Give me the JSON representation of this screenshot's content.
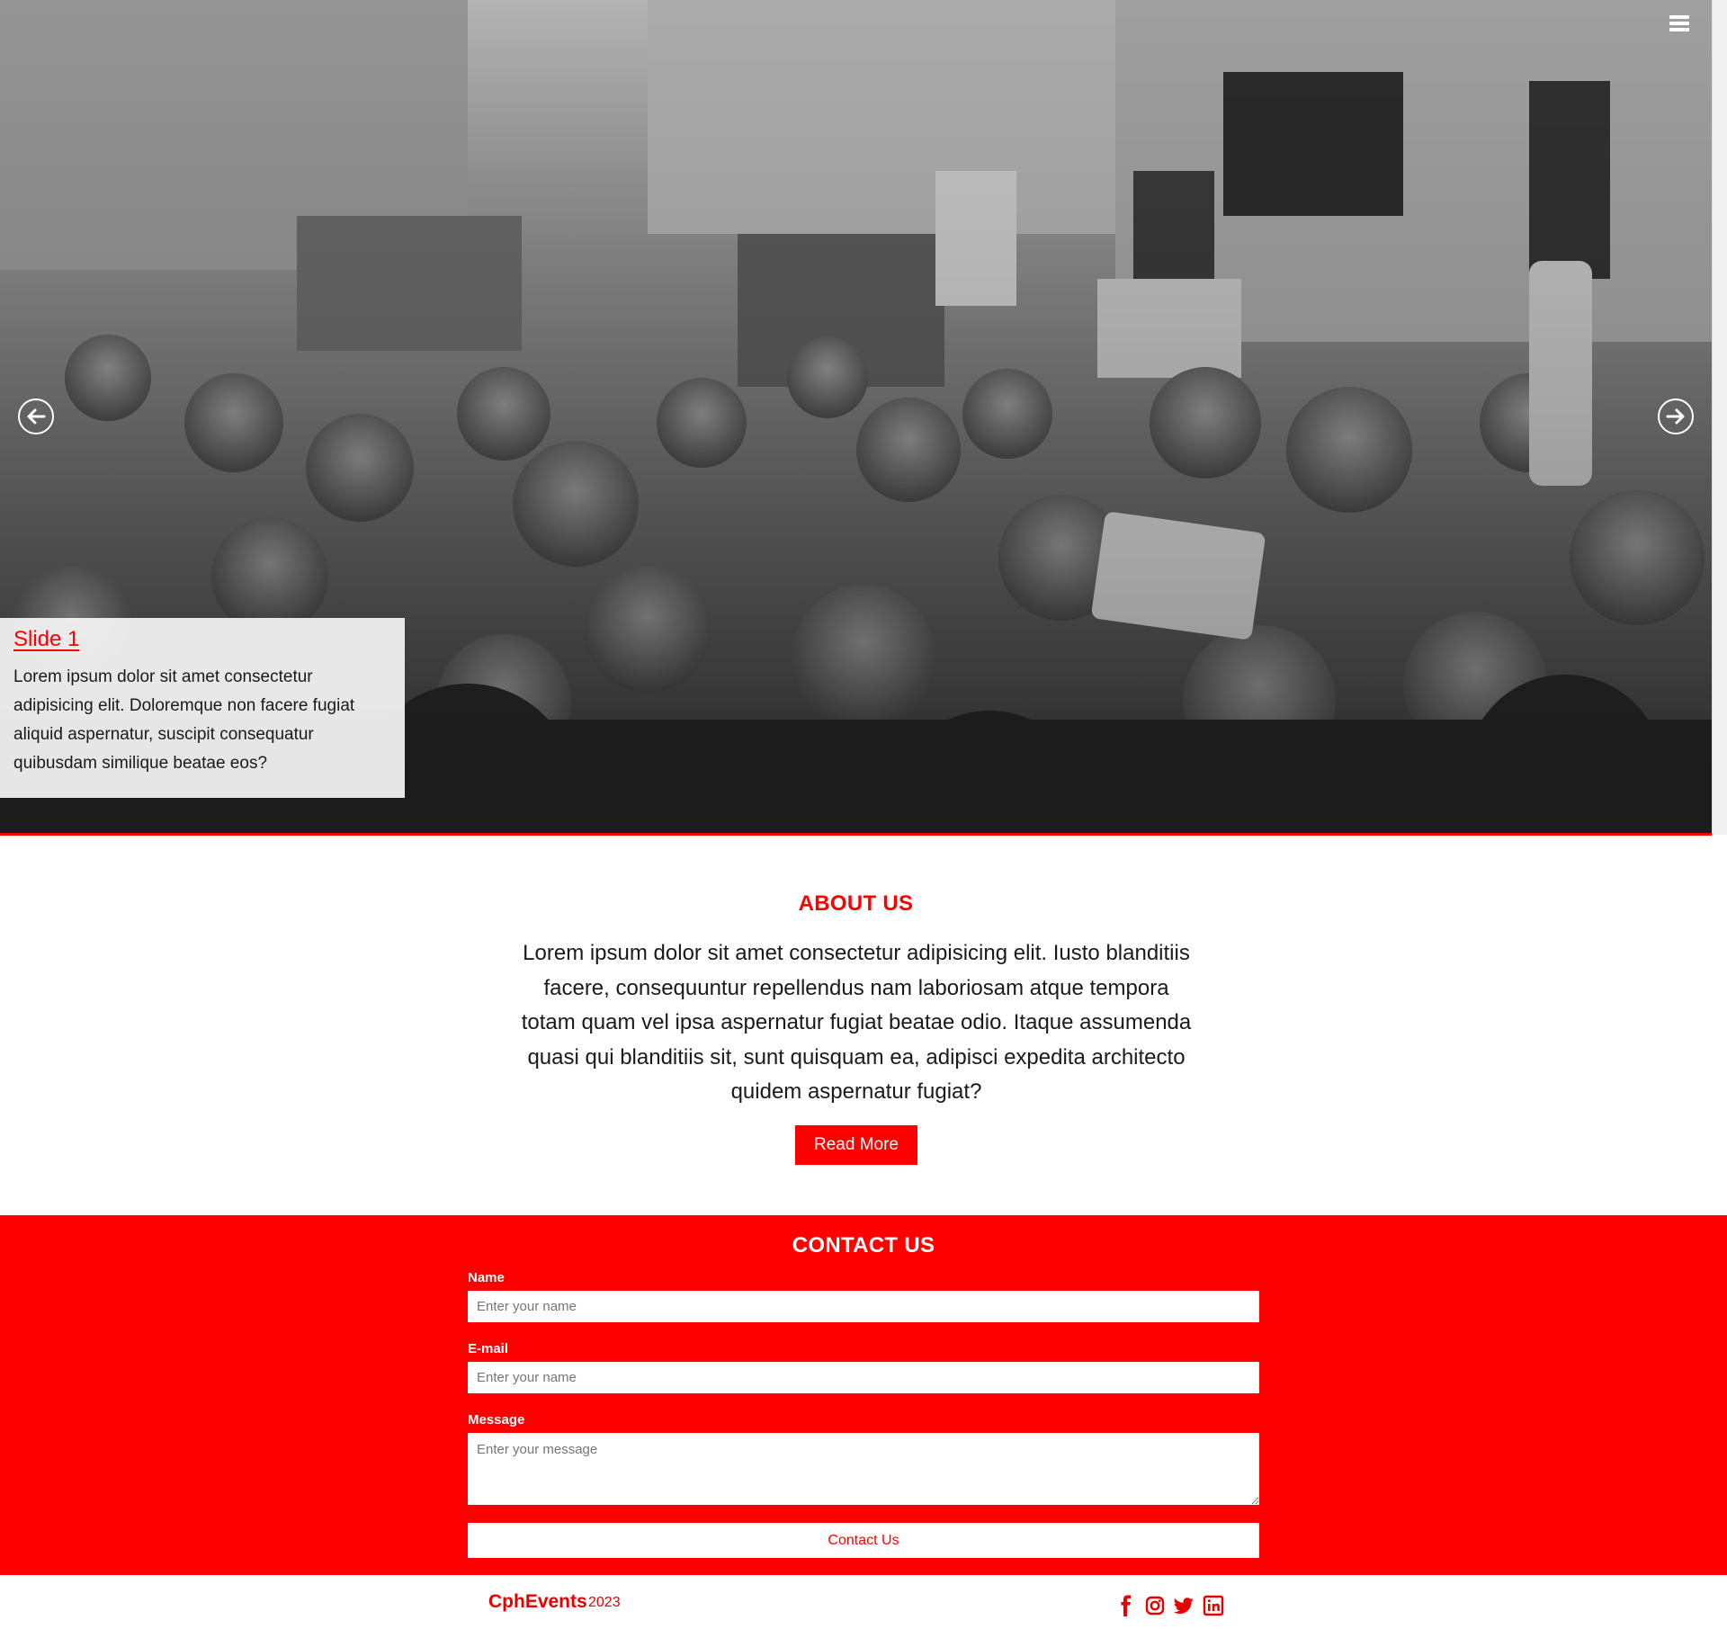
{
  "nav": {
    "menu_icon": "hamburger-icon"
  },
  "hero": {
    "prev_icon": "arrow-left-circle-icon",
    "next_icon": "arrow-right-circle-icon",
    "slide": {
      "title": "Slide 1",
      "text": "Lorem ipsum dolor sit amet consectetur adipisicing elit. Doloremque non facere fugiat aliquid aspernatur, suscipit consequatur quibusdam similique beatae eos?"
    }
  },
  "about": {
    "title": "ABOUT US",
    "text": "Lorem ipsum dolor sit amet consectetur adipisicing elit. Iusto blanditiis facere, consequuntur repellendus nam laboriosam atque tempora totam quam vel ipsa aspernatur fugiat beatae odio. Itaque assumenda quasi qui blanditiis sit, sunt quisquam ea, adipisci expedita architecto quidem aspernatur fugiat?",
    "button_label": "Read More"
  },
  "contact": {
    "title": "CONTACT US",
    "name_label": "Name",
    "name_placeholder": "Enter your name",
    "email_label": "E-mail",
    "email_placeholder": "Enter your name",
    "message_label": "Message",
    "message_placeholder": "Enter your message",
    "button_label": "Contact Us"
  },
  "footer": {
    "brand": "CphEvents",
    "year": "2023",
    "social_icons": [
      "facebook-icon",
      "instagram-icon",
      "twitter-icon",
      "linkedin-icon"
    ]
  },
  "colors": {
    "accent": "#ff0000",
    "text": "#1a1a1a",
    "white": "#ffffff"
  }
}
